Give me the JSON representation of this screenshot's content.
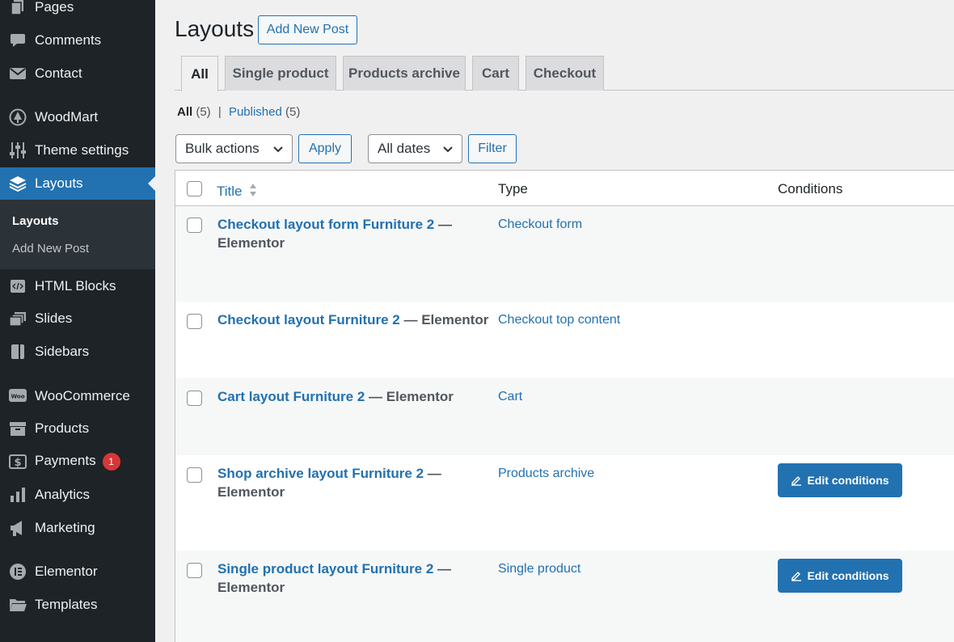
{
  "sidebar": {
    "items": [
      {
        "label": "Pages",
        "icon": "pages-icon"
      },
      {
        "label": "Comments",
        "icon": "comments-icon"
      },
      {
        "label": "Contact",
        "icon": "mail-icon"
      },
      {
        "label": "WoodMart",
        "icon": "woodmart-icon"
      },
      {
        "label": "Theme settings",
        "icon": "sliders-icon"
      },
      {
        "label": "Layouts",
        "icon": "layers-icon"
      },
      {
        "label": "HTML Blocks",
        "icon": "html-block-icon"
      },
      {
        "label": "Slides",
        "icon": "slides-icon"
      },
      {
        "label": "Sidebars",
        "icon": "sidebar-icon"
      },
      {
        "label": "WooCommerce",
        "icon": "woocommerce-icon"
      },
      {
        "label": "Products",
        "icon": "archive-box-icon"
      },
      {
        "label": "Payments",
        "icon": "dollar-icon",
        "badge": "1"
      },
      {
        "label": "Analytics",
        "icon": "bar-chart-icon"
      },
      {
        "label": "Marketing",
        "icon": "megaphone-icon"
      },
      {
        "label": "Elementor",
        "icon": "elementor-icon"
      },
      {
        "label": "Templates",
        "icon": "folder-icon"
      }
    ],
    "submenu": [
      "Layouts",
      "Add New Post"
    ]
  },
  "header": {
    "title": "Layouts",
    "add_new": "Add New Post"
  },
  "tabs": [
    "All",
    "Single product",
    "Products archive",
    "Cart",
    "Checkout"
  ],
  "filters": {
    "all_label": "All",
    "all_count": "(5)",
    "separator": "|",
    "published_label": "Published",
    "published_count": "(5)"
  },
  "toolbar": {
    "bulk_actions": "Bulk actions",
    "apply": "Apply",
    "all_dates": "All dates",
    "filter": "Filter"
  },
  "table": {
    "columns": [
      "Title",
      "Type",
      "Conditions"
    ],
    "rows": [
      {
        "title": "Checkout layout form Furniture 2",
        "suffix": " — Elementor",
        "type": "Checkout form",
        "has_conditions": false
      },
      {
        "title": "Checkout layout Furniture 2",
        "suffix": " — Elementor",
        "type": "Checkout top content",
        "has_conditions": false
      },
      {
        "title": "Cart layout Furniture 2",
        "suffix": " — Elementor",
        "type": "Cart",
        "has_conditions": false
      },
      {
        "title": "Shop archive layout Furniture 2",
        "suffix": " — Elementor",
        "type": "Products archive",
        "has_conditions": true
      },
      {
        "title": "Single product layout Furniture 2",
        "suffix": " — Elementor",
        "type": "Single product",
        "has_conditions": true
      }
    ],
    "edit_conditions": "Edit conditions"
  },
  "colors": {
    "sidebar_bg": "#1d2327",
    "accent": "#2271b1",
    "badge": "#d63638"
  }
}
